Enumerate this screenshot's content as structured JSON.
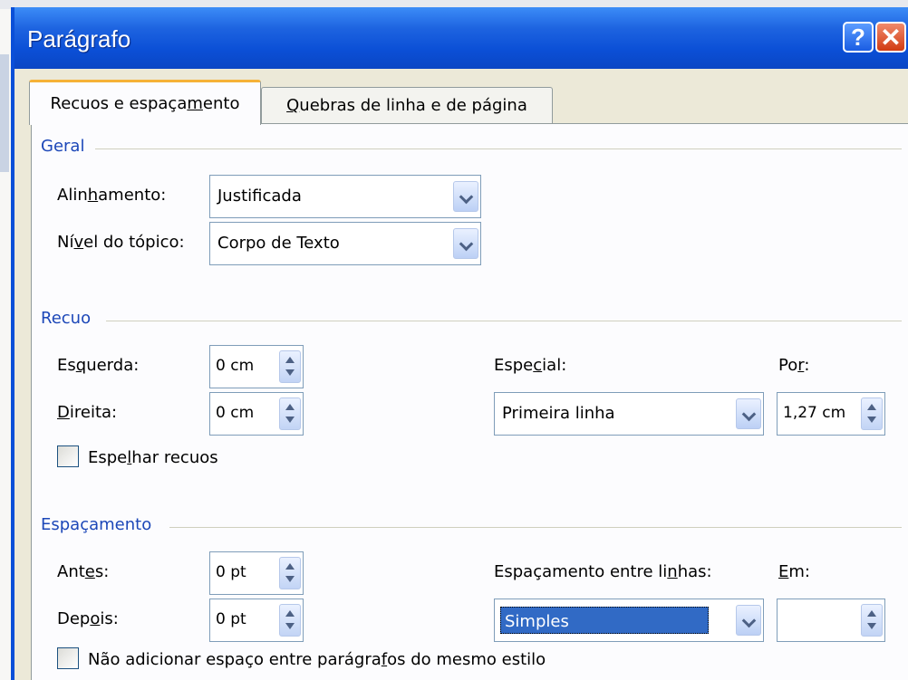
{
  "window": {
    "title": "Parágrafo",
    "help_label": "?",
    "close_label": "✕"
  },
  "tabs": [
    {
      "pre": "Recuos e espaça",
      "key": "m",
      "post": "ento",
      "active": true
    },
    {
      "pre": "",
      "key": "Q",
      "post": "uebras de linha e de página",
      "active": false
    }
  ],
  "geral": {
    "title": "Geral",
    "alinhamento": {
      "pre": "Alin",
      "key": "h",
      "post": "amento:",
      "value": "Justificada"
    },
    "nivel": {
      "pre": "Ní",
      "key": "v",
      "post": "el do tópico:",
      "value": "Corpo de Texto"
    }
  },
  "recuo": {
    "title": "Recuo",
    "esquerda": {
      "pre": "Es",
      "key": "q",
      "post": "uerda:",
      "value": "0 cm"
    },
    "direita": {
      "pre": "",
      "key": "D",
      "post": "ireita:",
      "value": "0 cm"
    },
    "especial": {
      "pre": "Espe",
      "key": "c",
      "post": "ial:",
      "value": "Primeira linha"
    },
    "por": {
      "pre": "Po",
      "key": "r",
      "post": ":",
      "value": "1,27 cm"
    },
    "espelhar": {
      "pre": "Espe",
      "key": "l",
      "post": "har recuos",
      "checked": false
    }
  },
  "espacamento": {
    "title": "Espaçamento",
    "antes": {
      "pre": "Ant",
      "key": "e",
      "post": "s:",
      "value": "0 pt"
    },
    "depois": {
      "pre": "Dep",
      "key": "o",
      "post": "is:",
      "value": "0 pt"
    },
    "entre_linhas": {
      "pre": "Espaçamento entre li",
      "key": "n",
      "post": "has:",
      "value": "Simples"
    },
    "em": {
      "pre": "",
      "key": "E",
      "post": "m:",
      "value": ""
    },
    "nao_adicionar": {
      "pre": "Não adicionar espaço entre parágra",
      "key": "f",
      "post": "os do mesmo estilo",
      "checked": false
    }
  },
  "icons": {
    "dropdown": "chevron-down-icon",
    "spinner": "spinner-arrows-icon"
  },
  "colors": {
    "titlebar": "#0b4fd6",
    "section_title": "#1c47b8",
    "selection": "#316ac5",
    "active_tab_accent": "#f5b237"
  }
}
